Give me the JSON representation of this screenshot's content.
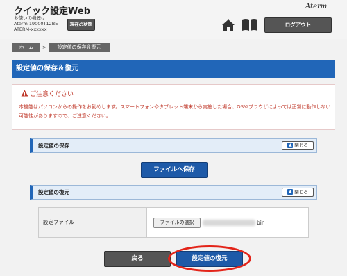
{
  "header": {
    "app_title": "クイック設定Web",
    "device_label": "お使いの機器は",
    "device_model": "Aterm 19000T12BE",
    "device_ssid": "ATERM-xxxxxx",
    "status_button": "現在の状態",
    "brand": "Aterm",
    "logout_button": "ログアウト"
  },
  "breadcrumb": {
    "home": "ホーム",
    "separator": ">",
    "current": "設定値の保存＆復元"
  },
  "page_title": "設定値の保存＆復元",
  "notice": {
    "title": "ご注意ください",
    "text": "本機能はパソコンからの操作をお勧めします。スマートフォンやタブレット端末から実施した場合、OSやブラウザによっては正常に動作しない可能性がありますので、ご注意ください。"
  },
  "save_section": {
    "title": "設定値の保存",
    "close_button": "閉じる",
    "save_button": "ファイルへ保存"
  },
  "restore_section": {
    "title": "設定値の復元",
    "close_button": "閉じる",
    "file_label": "設定ファイル",
    "file_select_button": "ファイルの選択",
    "file_extension": "bin"
  },
  "footer": {
    "back_button": "戻る",
    "restore_button": "設定値の復元"
  },
  "colors": {
    "accent_blue": "#2166b8",
    "button_gray": "#555555",
    "warning_red": "#c0392b",
    "highlight_red": "#e32419"
  }
}
